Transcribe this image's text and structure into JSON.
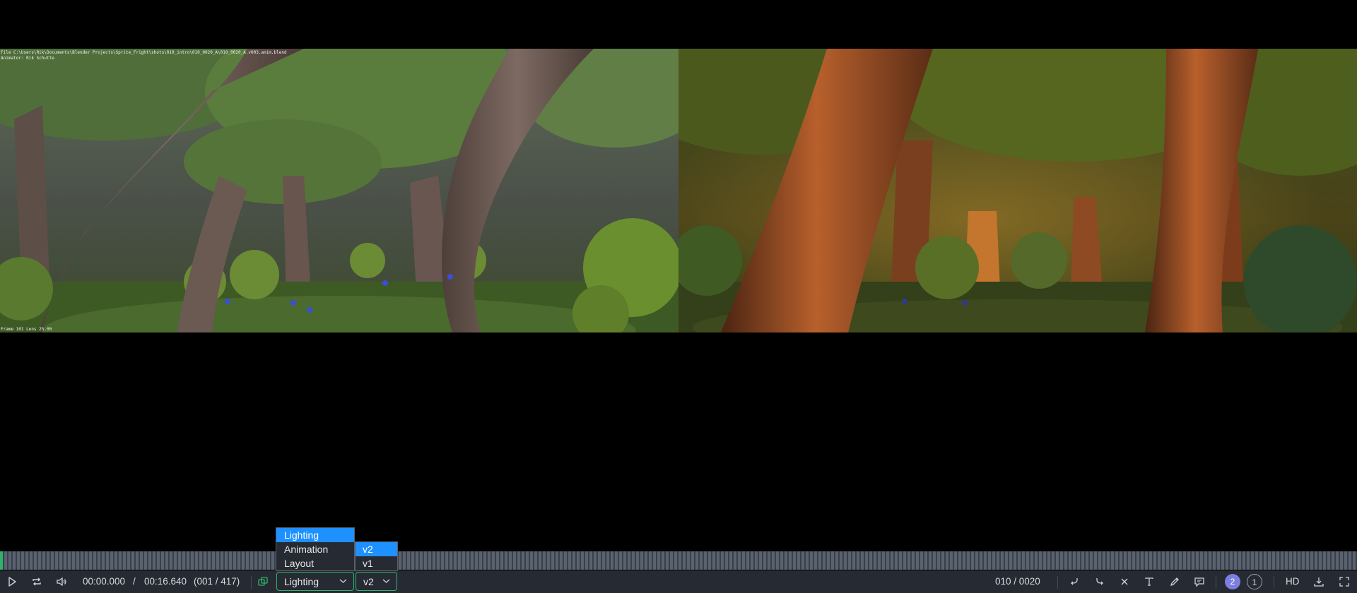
{
  "overlay": {
    "file_path": "File C:\\Users\\Rik\\Documents\\Blender Projects\\Sprite_Fright\\shots\\010_intro\\010_0020_A\\010_0020_A.v003.anim.blend",
    "animator": "Animator: Rik Schutte",
    "frame_info": "Frame 101   Lens 25.00"
  },
  "player": {
    "current_time": "00:00.000",
    "separator": "/",
    "total_time": "00:16.640",
    "frame_range": "(001 / 417)"
  },
  "department_select": {
    "value": "Lighting",
    "options": [
      "Lighting",
      "Animation",
      "Layout"
    ],
    "selected_index": 0
  },
  "version_select": {
    "value": "v2",
    "options": [
      "v2",
      "v1"
    ],
    "selected_index": 0
  },
  "shot_counter": "010 / 0020",
  "compare": {
    "left_badge": "2",
    "right_badge": "1"
  },
  "quality_label": "HD",
  "colors": {
    "accent_green": "#2fb36b",
    "selection_blue": "#1e90ff",
    "bar_background": "#262b33",
    "badge_purple": "#7b7fe0"
  },
  "icons": {
    "play": "play-icon",
    "loop": "loop-icon",
    "volume": "volume-icon",
    "compare": "compare-icon",
    "undo": "undo-icon",
    "redo": "redo-icon",
    "clear": "close-icon",
    "text": "text-icon",
    "draw": "pencil-icon",
    "comment": "comment-icon",
    "download": "download-icon",
    "fullscreen": "fullscreen-icon"
  }
}
